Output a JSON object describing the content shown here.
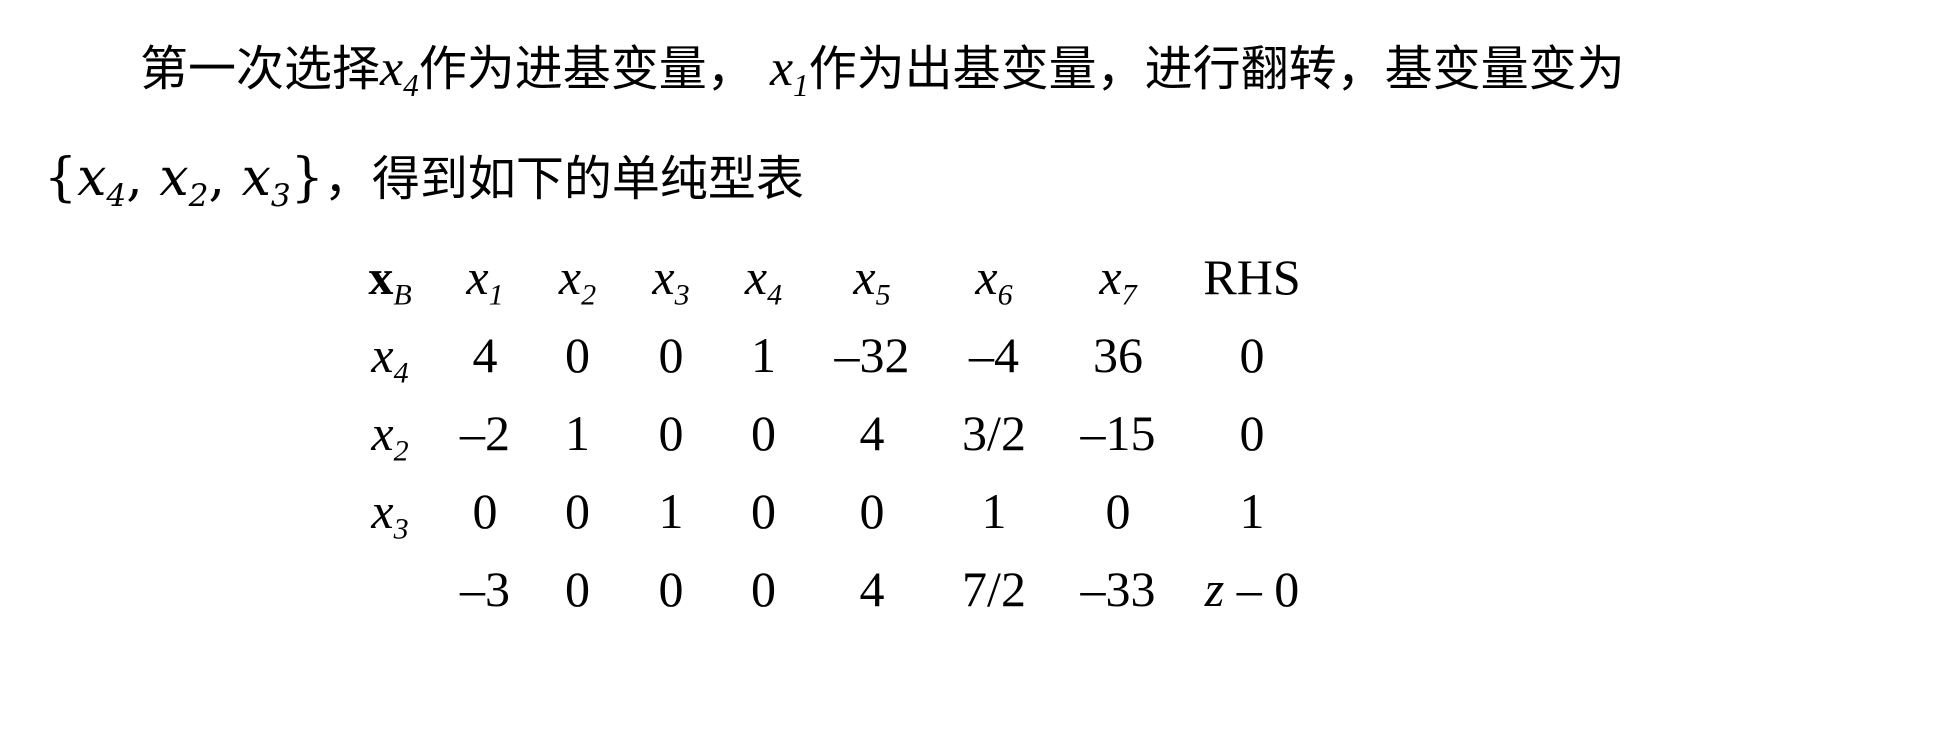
{
  "paragraph": {
    "line1_parts": [
      "第一次选择",
      "x",
      "4",
      "作为进基变量， ",
      "x",
      "1",
      "作为出基变量，进行翻转，基变量变为"
    ],
    "basis_set": {
      "open": "{",
      "v1": "x",
      "s1": "4",
      "sep1": ", ",
      "v2": "x",
      "s2": "2",
      "sep2": ", ",
      "v3": "x",
      "s3": "3",
      "close": "}"
    },
    "line2_suffix": "，得到如下的单纯型表"
  },
  "table": {
    "header": {
      "basis_label": "x",
      "basis_sub": "B",
      "columns": [
        {
          "v": "x",
          "s": "1"
        },
        {
          "v": "x",
          "s": "2"
        },
        {
          "v": "x",
          "s": "3"
        },
        {
          "v": "x",
          "s": "4"
        },
        {
          "v": "x",
          "s": "5"
        },
        {
          "v": "x",
          "s": "6"
        },
        {
          "v": "x",
          "s": "7"
        }
      ],
      "rhs": "RHS"
    },
    "rows": [
      {
        "basis_v": "x",
        "basis_s": "4",
        "values": [
          "4",
          "0",
          "0",
          "1",
          "–32",
          "–4",
          "36"
        ],
        "rhs": "0"
      },
      {
        "basis_v": "x",
        "basis_s": "2",
        "values": [
          "–2",
          "1",
          "0",
          "0",
          "4",
          "3/2",
          "–15"
        ],
        "rhs": "0"
      },
      {
        "basis_v": "x",
        "basis_s": "3",
        "values": [
          "0",
          "0",
          "1",
          "0",
          "0",
          "1",
          "0"
        ],
        "rhs": "1"
      }
    ],
    "objective_row": {
      "values": [
        "–3",
        "0",
        "0",
        "0",
        "4",
        "7/2",
        "–33"
      ],
      "rhs_var": "z",
      "rhs_rest": " – 0"
    }
  }
}
